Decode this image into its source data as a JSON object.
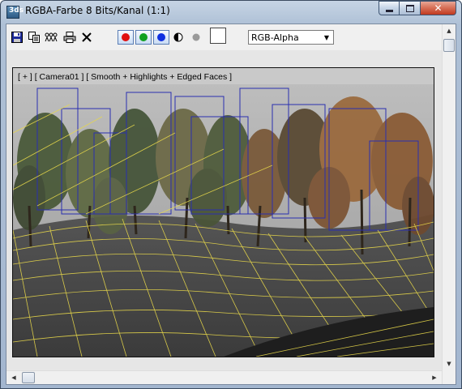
{
  "window": {
    "title": "RGBA-Farbe 8 Bits/Kanal (1:1)",
    "app_icon_text": "3ds"
  },
  "toolbar": {
    "channel_select": {
      "selected": "RGB-Alpha"
    }
  },
  "viewport": {
    "label": "[ + ] [ Camera01 ] [ Smooth + Highlights + Edged Faces ]"
  },
  "colors": {
    "red_channel": "#e01010",
    "green_channel": "#10a020",
    "blue_channel": "#1030e0",
    "wireframe": "#e8d84a",
    "bounding_boxes": "#2a2fb0"
  }
}
